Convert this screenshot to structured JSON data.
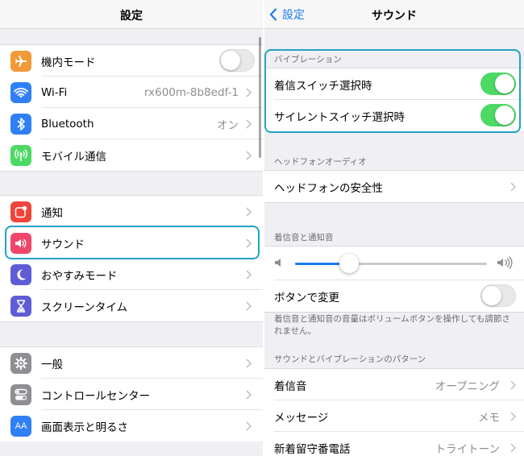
{
  "left": {
    "title": "設定",
    "group1": [
      {
        "label": "機内モード",
        "icon": "airplane-icon",
        "color": "#f19a37",
        "toggle": false
      },
      {
        "label": "Wi-Fi",
        "icon": "wifi-icon",
        "color": "#2f80f6",
        "value": "rx600m-8b8edf-1"
      },
      {
        "label": "Bluetooth",
        "icon": "bluetooth-icon",
        "color": "#2f80f6",
        "value": "オン"
      },
      {
        "label": "モバイル通信",
        "icon": "antenna-icon",
        "color": "#4cd964"
      }
    ],
    "group2": [
      {
        "label": "通知",
        "icon": "notification-icon",
        "color": "#f0453a"
      },
      {
        "label": "サウンド",
        "icon": "speaker-icon",
        "color": "#f0466b"
      },
      {
        "label": "おやすみモード",
        "icon": "moon-icon",
        "color": "#5f5cd6"
      },
      {
        "label": "スクリーンタイム",
        "icon": "hourglass-icon",
        "color": "#5f5cd6"
      }
    ],
    "group3": [
      {
        "label": "一般",
        "icon": "gear-icon",
        "color": "#8e8e93"
      },
      {
        "label": "コントロールセンター",
        "icon": "control-center-icon",
        "color": "#8e8e93"
      },
      {
        "label": "画面表示と明るさ",
        "icon": "text-size-icon",
        "color": "#2f80f6",
        "icon_text": "AA"
      }
    ]
  },
  "right": {
    "title": "サウンド",
    "back_label": "設定",
    "vibration": {
      "header": "バイブレーション",
      "rows": [
        {
          "label": "着信スイッチ選択時",
          "toggle": true
        },
        {
          "label": "サイレントスイッチ選択時",
          "toggle": true
        }
      ]
    },
    "headphone": {
      "header": "ヘッドフォンオーディオ",
      "row_label": "ヘッドフォンの安全性"
    },
    "ringer": {
      "header": "着信音と通知音",
      "volume": 0.28,
      "change_with_buttons_label": "ボタンで変更",
      "change_with_buttons_toggle": false,
      "footer": "着信音と通知音の音量はボリュームボタンを操作しても調節されません。"
    },
    "patterns": {
      "header": "サウンドとバイブレーションのパターン",
      "rows": [
        {
          "label": "着信音",
          "value": "オープニング"
        },
        {
          "label": "メッセージ",
          "value": "メモ"
        },
        {
          "label": "新着留守番電話",
          "value": "トライトーン"
        }
      ]
    }
  },
  "colors": {
    "accent": "#1a7bf1",
    "toggle_on": "#4cd964",
    "highlight": "#22a3c2"
  }
}
